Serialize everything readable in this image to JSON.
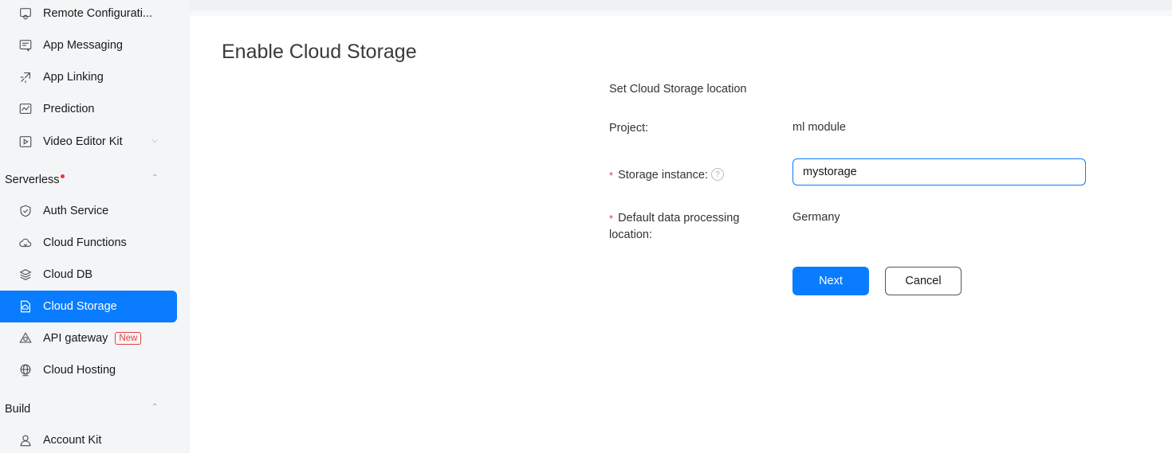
{
  "sidebar": {
    "items_top": [
      {
        "label": "Remote Configurati...",
        "icon": "gear-icon"
      },
      {
        "label": "App Messaging",
        "icon": "message-icon"
      },
      {
        "label": "App Linking",
        "icon": "link-icon"
      },
      {
        "label": "Prediction",
        "icon": "chart-icon"
      },
      {
        "label": "Video Editor Kit",
        "icon": "video-icon"
      }
    ],
    "section_serverless": "Serverless",
    "serverless_items": [
      {
        "label": "Auth Service",
        "icon": "shield-icon"
      },
      {
        "label": "Cloud Functions",
        "icon": "cloud-icon"
      },
      {
        "label": "Cloud DB",
        "icon": "database-icon"
      },
      {
        "label": "Cloud Storage",
        "icon": "storage-icon"
      },
      {
        "label": "API gateway",
        "icon": "gateway-icon",
        "badge": "New"
      },
      {
        "label": "Cloud Hosting",
        "icon": "globe-icon"
      }
    ],
    "section_build": "Build",
    "build_items": [
      {
        "label": "Account Kit",
        "icon": "user-icon"
      }
    ]
  },
  "main": {
    "title": "Enable Cloud Storage",
    "form_heading": "Set Cloud Storage location",
    "project_label": "Project:",
    "project_value": "ml module",
    "storage_label": "Storage instance:",
    "storage_value": "mystorage",
    "help_icon": "?",
    "location_label_line1": "Default data processing",
    "location_label_line2": "location:",
    "location_value": "Germany",
    "required_mark": "*",
    "next_label": "Next",
    "cancel_label": "Cancel"
  },
  "colors": {
    "accent": "#0a7cff",
    "required": "#e5383b",
    "badge": "#e84040"
  }
}
